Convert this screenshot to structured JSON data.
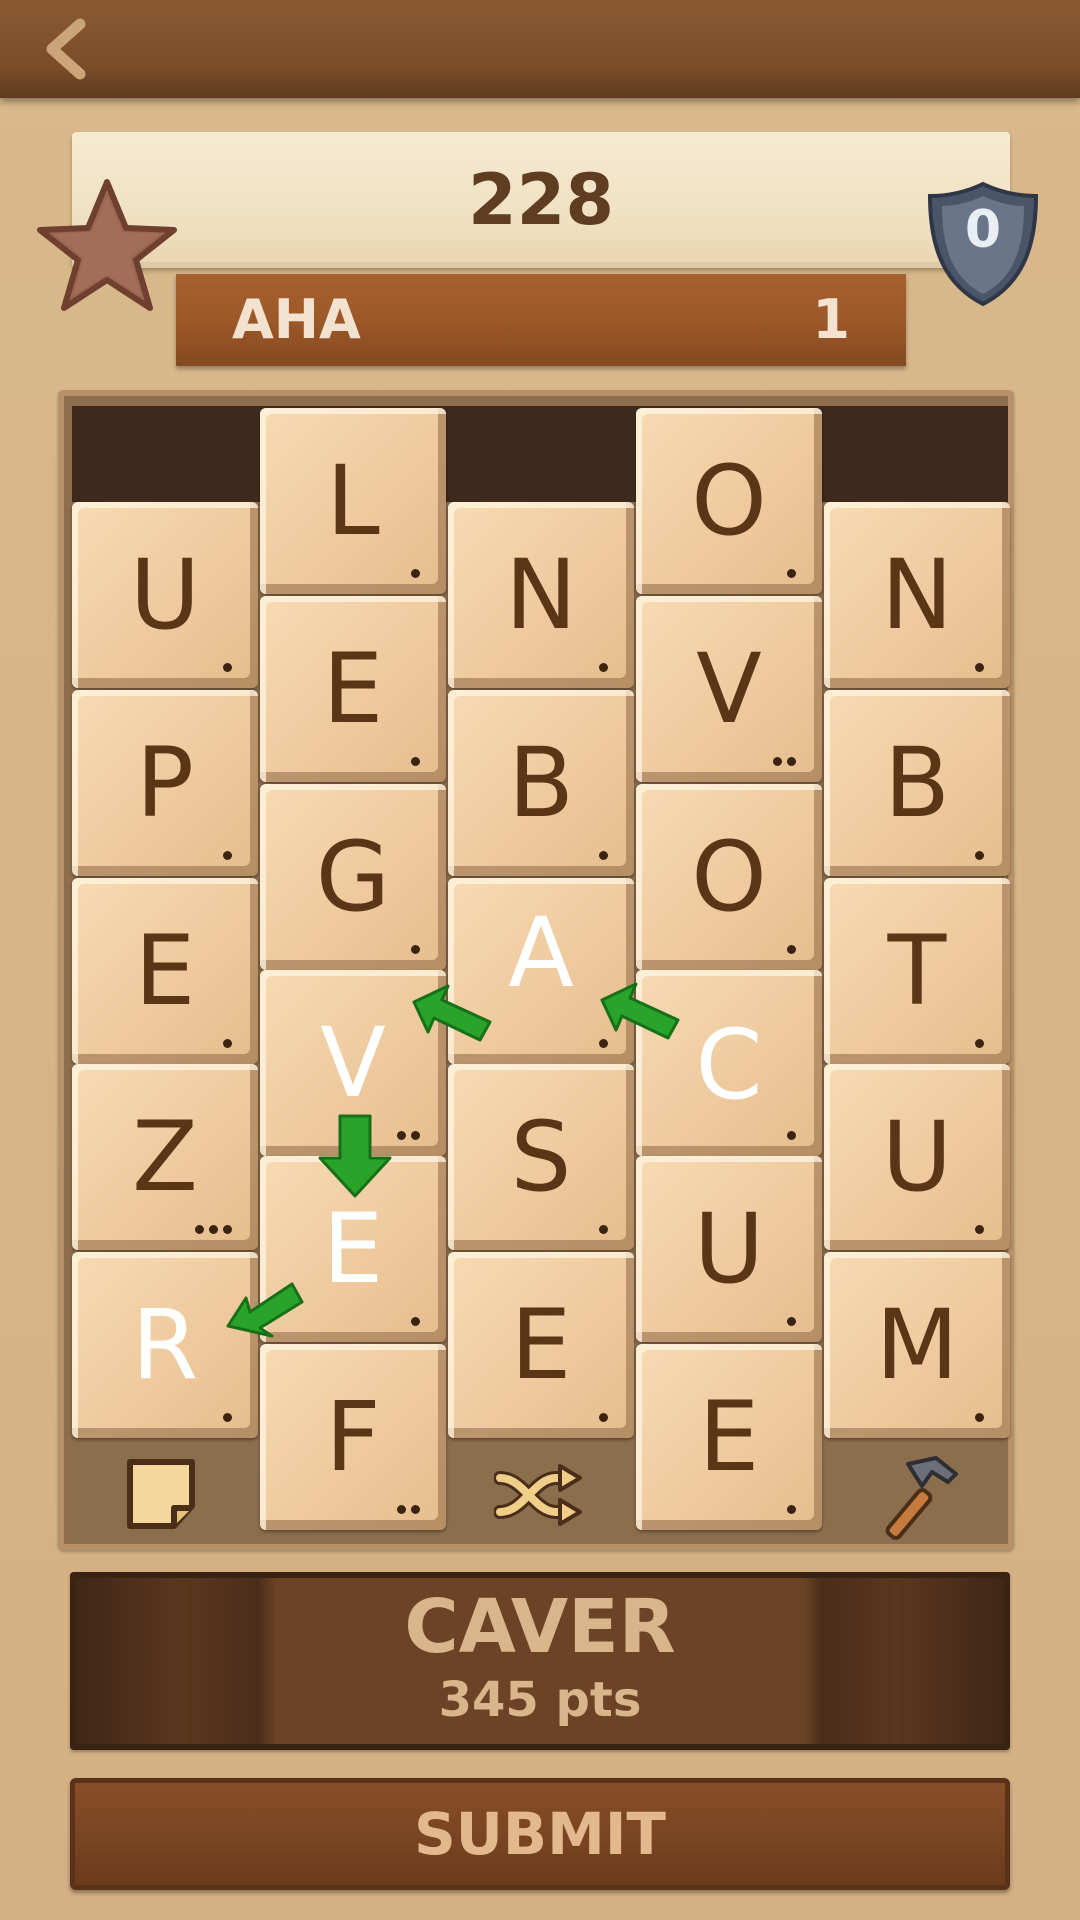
{
  "header": {
    "back_icon": "chevron-left-icon"
  },
  "score": {
    "value": "228",
    "star_icon": "star-icon"
  },
  "shield": {
    "value": "0",
    "icon": "shield-icon"
  },
  "last_word": {
    "word": "AHA",
    "count": "1"
  },
  "board": {
    "columns": [
      {
        "col": 0,
        "tiles": [
          {
            "letter": "U",
            "dots": 1
          },
          {
            "letter": "P",
            "dots": 1
          },
          {
            "letter": "E",
            "dots": 1
          },
          {
            "letter": "Z",
            "dots": 3
          },
          {
            "letter": "R",
            "dots": 1,
            "selected": true
          }
        ]
      },
      {
        "col": 1,
        "tiles": [
          {
            "letter": "L",
            "dots": 1
          },
          {
            "letter": "E",
            "dots": 1
          },
          {
            "letter": "G",
            "dots": 1
          },
          {
            "letter": "V",
            "dots": 2,
            "selected": true
          },
          {
            "letter": "E",
            "dots": 1,
            "selected": true
          },
          {
            "letter": "F",
            "dots": 2
          }
        ]
      },
      {
        "col": 2,
        "tiles": [
          {
            "letter": "N",
            "dots": 1
          },
          {
            "letter": "B",
            "dots": 1
          },
          {
            "letter": "A",
            "dots": 1,
            "selected": true
          },
          {
            "letter": "S",
            "dots": 1
          },
          {
            "letter": "E",
            "dots": 1
          }
        ]
      },
      {
        "col": 3,
        "tiles": [
          {
            "letter": "O",
            "dots": 1
          },
          {
            "letter": "V",
            "dots": 2
          },
          {
            "letter": "O",
            "dots": 1
          },
          {
            "letter": "C",
            "dots": 1,
            "selected": true
          },
          {
            "letter": "U",
            "dots": 1
          },
          {
            "letter": "E",
            "dots": 1
          }
        ]
      },
      {
        "col": 4,
        "tiles": [
          {
            "letter": "N",
            "dots": 1
          },
          {
            "letter": "B",
            "dots": 1
          },
          {
            "letter": "T",
            "dots": 1
          },
          {
            "letter": "U",
            "dots": 1
          },
          {
            "letter": "M",
            "dots": 1
          }
        ]
      }
    ],
    "tools": [
      {
        "name": "note-icon"
      },
      {
        "name": "shuffle-icon"
      },
      {
        "name": "hammer-icon"
      }
    ]
  },
  "current": {
    "word": "CAVER",
    "points": "345 pts"
  },
  "submit": {
    "label": "SUBMIT"
  },
  "colors": {
    "arrow": "#2aa32a",
    "tile": "#f0cda2",
    "letter": "#5b3616"
  }
}
